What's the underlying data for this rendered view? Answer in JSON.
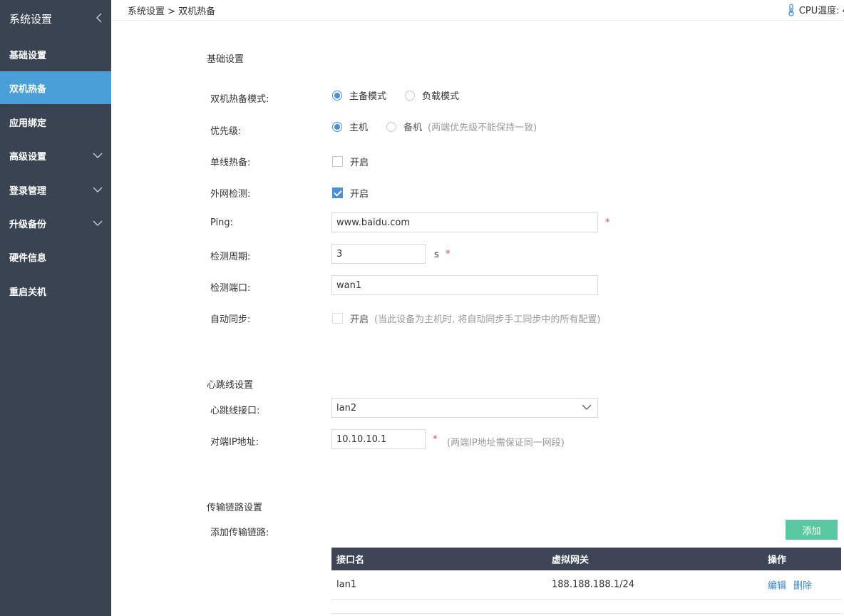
{
  "sidebar": {
    "title": "系统设置",
    "items": [
      {
        "label": "基础设置"
      },
      {
        "label": "双机热备"
      },
      {
        "label": "应用绑定"
      },
      {
        "label": "高级设置"
      },
      {
        "label": "登录管理"
      },
      {
        "label": "升级备份"
      },
      {
        "label": "硬件信息"
      },
      {
        "label": "重启关机"
      }
    ]
  },
  "header": {
    "breadcrumb": "系统设置 > 双机热备",
    "cpu_temp": "CPU温度: 4"
  },
  "basic": {
    "section_title": "基础设置",
    "mode_label": "双机热备模式:",
    "mode_options": [
      "主备模式",
      "负载模式"
    ],
    "mode_selected": "主备模式",
    "priority_label": "优先级:",
    "priority_options": [
      "主机",
      "备机"
    ],
    "priority_selected": "主机",
    "priority_hint": "(两端优先级不能保持一致)",
    "single_label": "单线热备:",
    "single_option": "开启",
    "single_checked": false,
    "wan_label": "外网检测:",
    "wan_option": "开启",
    "wan_checked": true,
    "ping_label": "Ping:",
    "ping_value": "www.baidu.com",
    "period_label": "检测周期:",
    "period_value": "3",
    "period_unit": "s",
    "port_label": "检测端口:",
    "port_value": "wan1",
    "sync_label": "自动同步:",
    "sync_option": "开启",
    "sync_checked": false,
    "sync_hint": "(当此设备为主机时, 将自动同步手工同步中的所有配置)",
    "required_mark": "*"
  },
  "heartbeat": {
    "section_title": "心跳线设置",
    "iface_label": "心跳线接口:",
    "iface_value": "lan2",
    "peer_label": "对端IP地址:",
    "peer_value": "10.10.10.1",
    "peer_hint": "(两端IP地址需保证同一网段)"
  },
  "transport": {
    "section_title": "传输链路设置",
    "add_label": "添加传输链路:",
    "add_button": "添加",
    "columns": [
      "接口名",
      "虚拟网关",
      "操作"
    ],
    "rows": [
      {
        "iface": "lan1",
        "gateway": "188.188.188.1/24",
        "edit": "编辑",
        "delete": "删除"
      }
    ]
  },
  "colors": {
    "sidebar_bg": "#3a4352",
    "active_item": "#4b9fd8",
    "accent": "#4b8fd8",
    "add_button": "#5ac8a0",
    "table_header": "#3e4556",
    "required": "#e0474c"
  }
}
